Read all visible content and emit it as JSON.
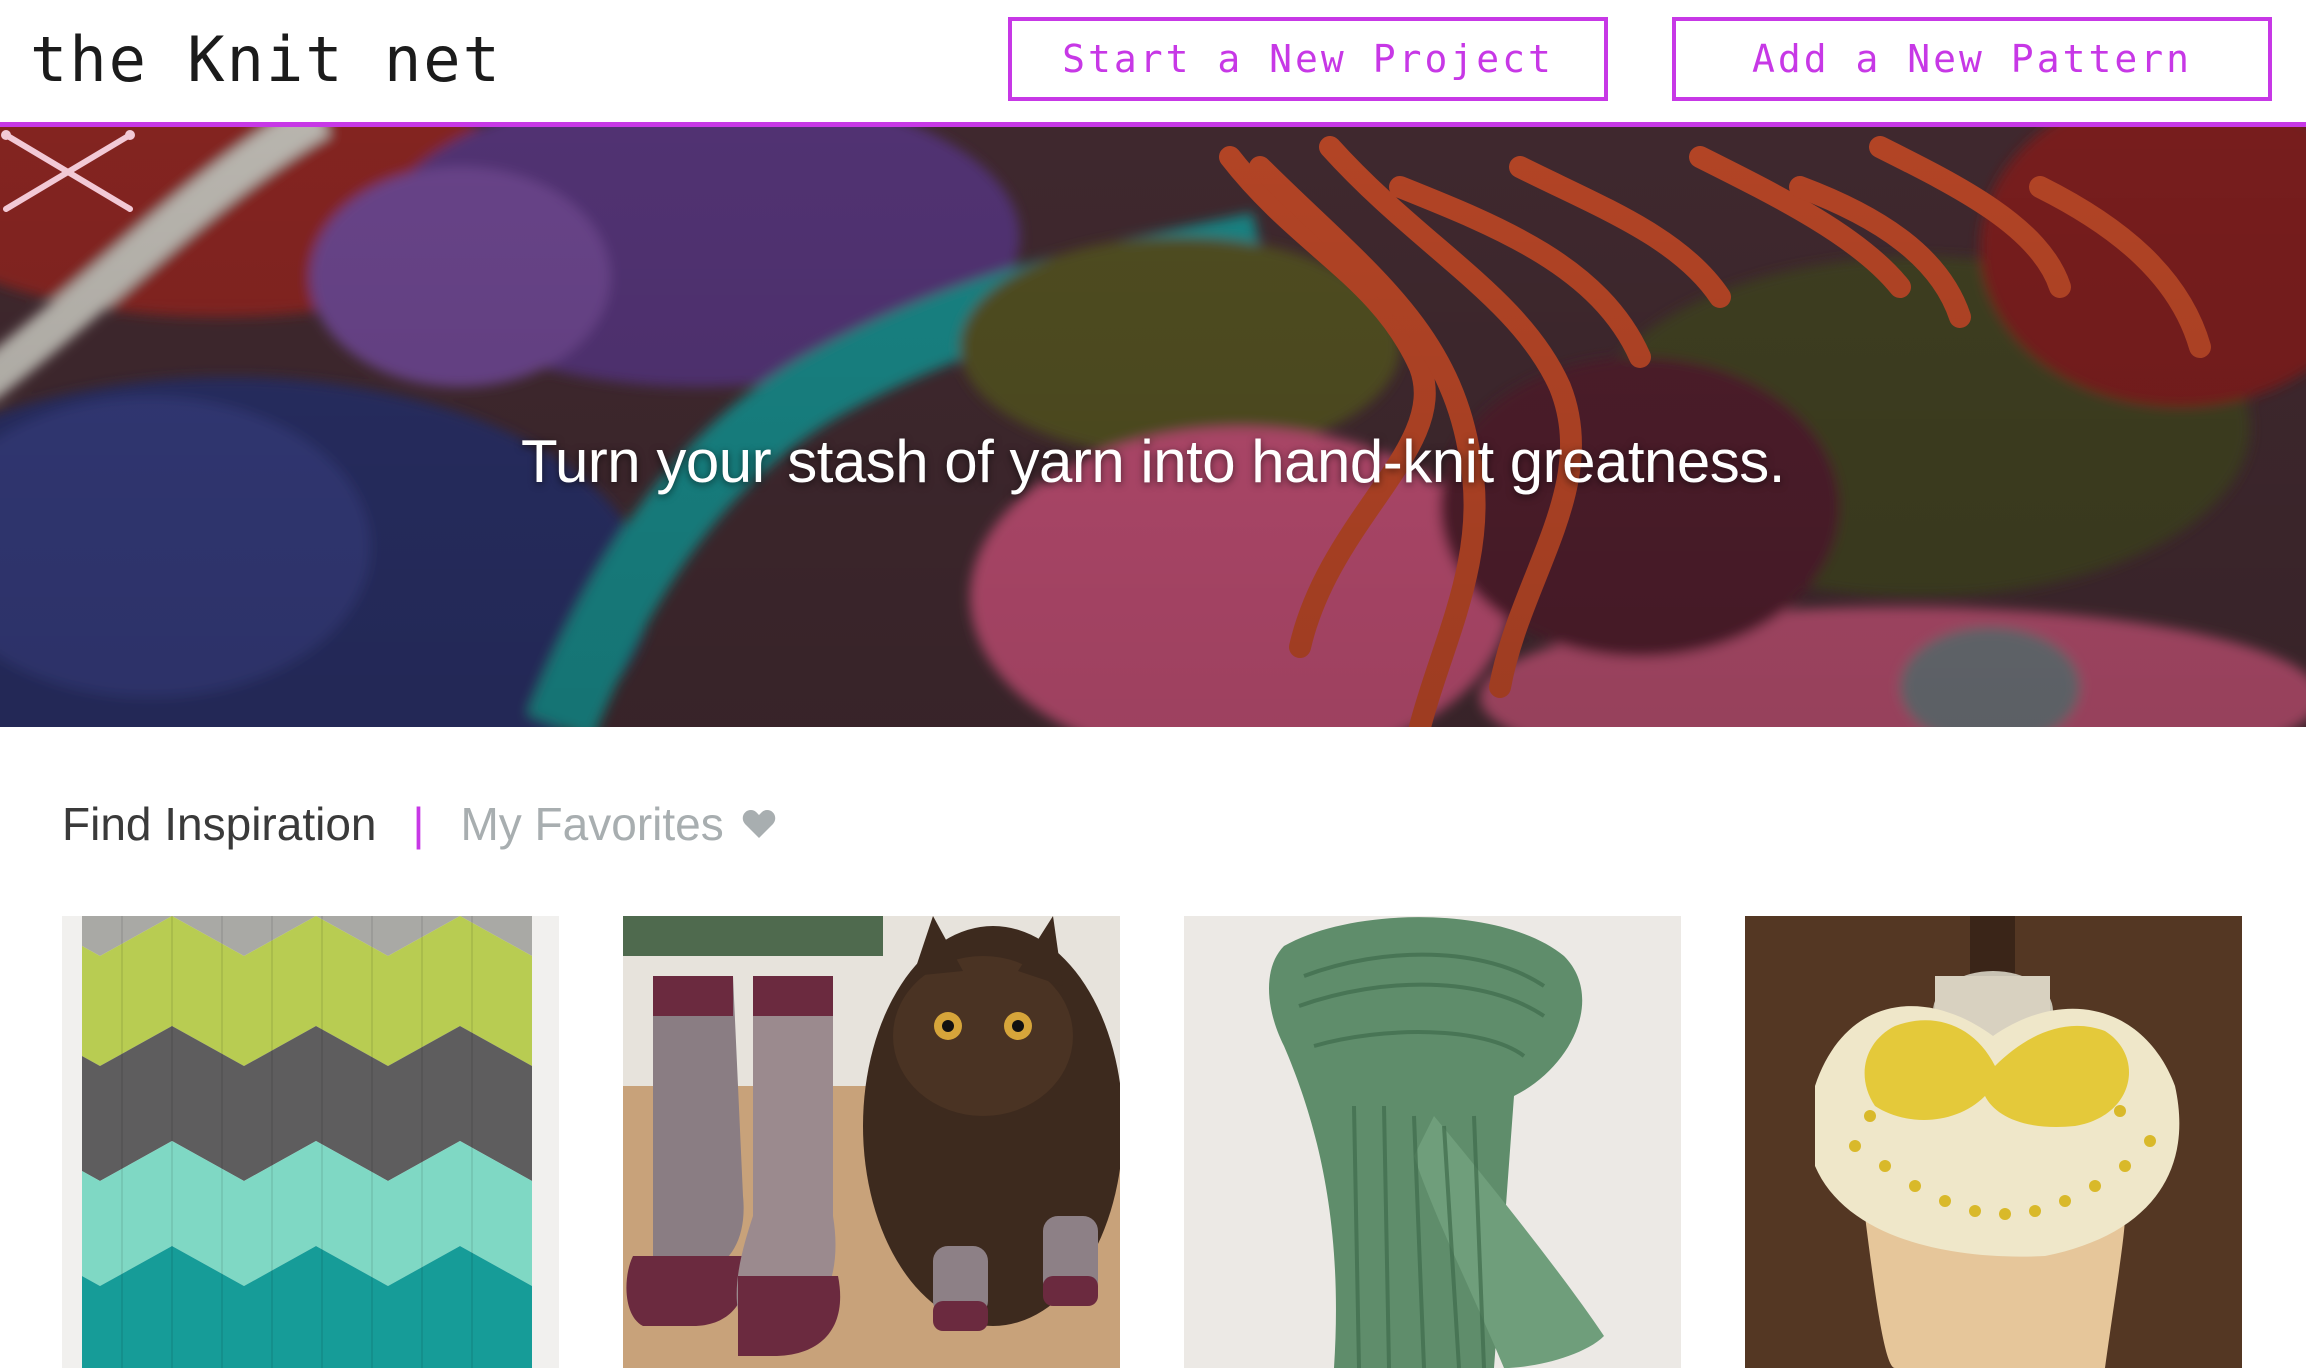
{
  "header": {
    "logo": "the Knit net",
    "start_project_label": "Start a New Project",
    "add_pattern_label": "Add a New Pattern"
  },
  "hero": {
    "tagline": "Turn your stash of yarn into hand-knit greatness.",
    "icon": "crossed-needles-icon"
  },
  "tabs": {
    "find_inspiration": "Find Inspiration",
    "separator": "|",
    "my_favorites": "My Favorites",
    "favorites_icon": "heart-icon"
  },
  "gallery": {
    "items": [
      {
        "image": "chevron-knit-blanket"
      },
      {
        "image": "knit-socks-with-cat"
      },
      {
        "image": "green-ribbed-scarf"
      },
      {
        "image": "yellow-cowl-on-dress-form"
      }
    ]
  },
  "colors": {
    "accent": "#c738e6",
    "tab_active": "#3a3a3a",
    "tab_inactive": "#a8aeb0"
  }
}
